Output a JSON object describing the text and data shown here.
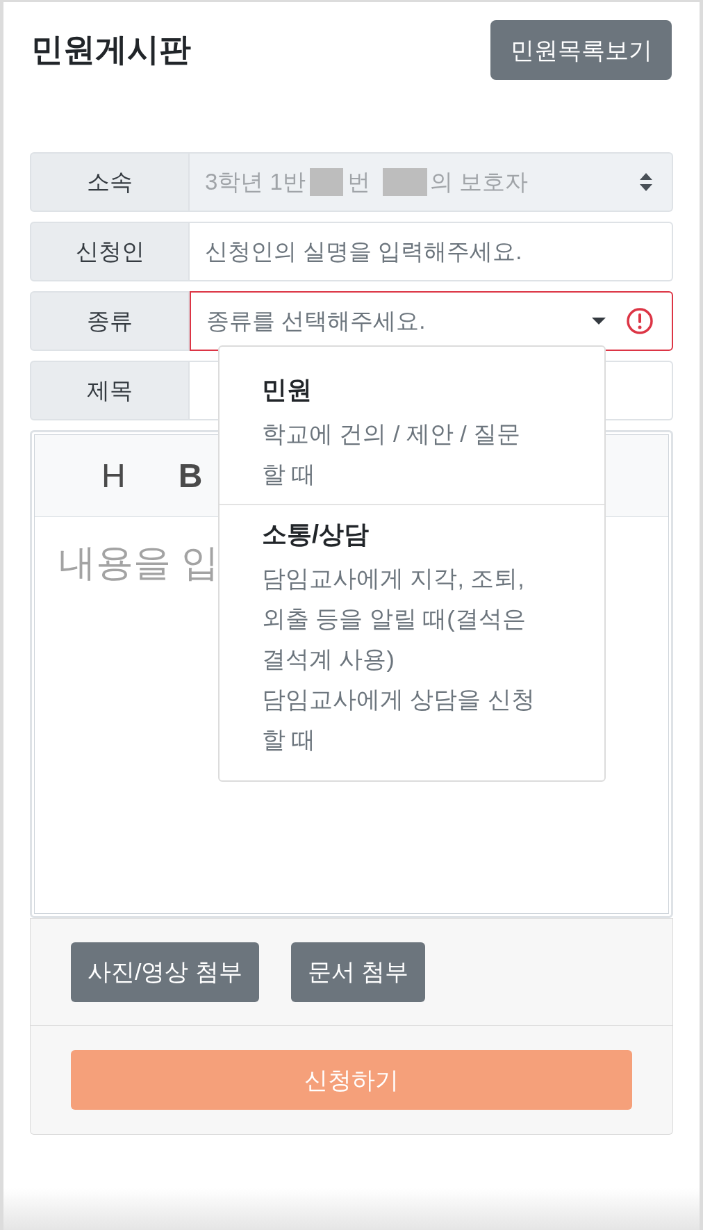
{
  "header": {
    "title": "민원게시판",
    "list_button": "민원목록보기"
  },
  "form": {
    "rows": [
      {
        "kind": "select",
        "label": "소속",
        "disabled": true,
        "invalid": false,
        "value_parts": [
          "3학년 1반",
          "번",
          "의 보호자"
        ]
      },
      {
        "kind": "input",
        "label": "신청인",
        "disabled": false,
        "invalid": false,
        "placeholder": "신청인의 실명을 입력해주세요."
      },
      {
        "kind": "dropdown",
        "label": "종류",
        "disabled": false,
        "invalid": true,
        "expanded": true,
        "placeholder": "종류를 선택해주세요."
      },
      {
        "kind": "input",
        "label": "제목",
        "disabled": false,
        "invalid": false
      }
    ]
  },
  "dropdown_menu": {
    "items": [
      {
        "title": "민원",
        "lines": [
          "학교에 건의 / 제안 / 질문 할 때"
        ]
      },
      {
        "title": "소통/상담",
        "lines": [
          "담임교사에게 지각, 조퇴, 외출 등을 알릴 때(결석은 결석계 사용)",
          "담임교사에게 상담을 신청 할 때"
        ]
      }
    ]
  },
  "editor": {
    "toolbar": [
      "H",
      "B"
    ],
    "placeholder": "내용을 입"
  },
  "attachments": [
    "사진/영상 첨부",
    "문서 첨부"
  ],
  "submit_button": "신청하기"
}
